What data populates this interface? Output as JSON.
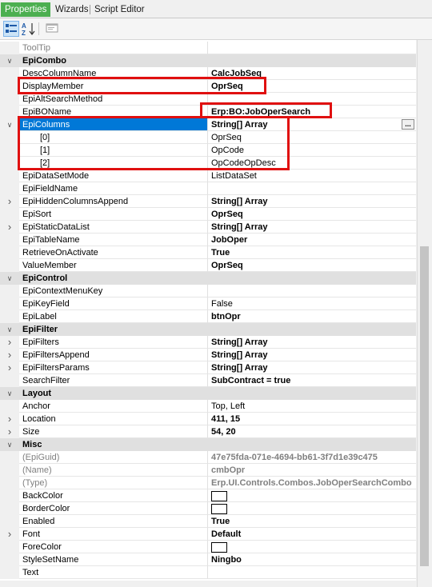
{
  "tabs": [
    {
      "label": "Properties",
      "active": true
    },
    {
      "label": "Wizards",
      "active": false
    },
    {
      "label": "Script Editor",
      "active": false
    }
  ],
  "toolbar": {
    "categorized_icon": "categorized-view-icon",
    "alphabetical_icon": "sort-alphabetical-icon",
    "property_pages_icon": "property-pages-icon",
    "alpha_label": "A",
    "alpha_label2": "Z"
  },
  "colors": {
    "accent_tab": "#4caf50",
    "selection": "#0078d7",
    "highlight_box": "#e01010"
  },
  "rows": [
    {
      "name": "ToolTip",
      "value": "",
      "kind": "prop",
      "readonly": true
    },
    {
      "name": "EpiCombo",
      "kind": "cat"
    },
    {
      "name": "DescColumnName",
      "value": "CalcJobSeq",
      "kind": "prop",
      "bold": true
    },
    {
      "name": "DisplayMember",
      "value": "OprSeq",
      "kind": "prop",
      "bold": true
    },
    {
      "name": "EpiAltSearchMethod",
      "value": "",
      "kind": "prop"
    },
    {
      "name": "EpiBOName",
      "value": "Erp:BO:JobOperSearch",
      "kind": "prop",
      "bold": true
    },
    {
      "name": "EpiColumns",
      "value": "String[] Array",
      "kind": "prop",
      "bold": true,
      "expanded": true,
      "selected": true,
      "ellipsis": true
    },
    {
      "name": "[0]",
      "value": "OprSeq",
      "kind": "sub"
    },
    {
      "name": "[1]",
      "value": "OpCode",
      "kind": "sub"
    },
    {
      "name": "[2]",
      "value": "OpCodeOpDesc",
      "kind": "sub"
    },
    {
      "name": "EpiDataSetMode",
      "value": "ListDataSet",
      "kind": "prop"
    },
    {
      "name": "EpiFieldName",
      "value": "",
      "kind": "prop"
    },
    {
      "name": "EpiHiddenColumnsAppend",
      "value": "String[] Array",
      "kind": "prop",
      "bold": true,
      "expandable": true
    },
    {
      "name": "EpiSort",
      "value": "OprSeq",
      "kind": "prop",
      "bold": true
    },
    {
      "name": "EpiStaticDataList",
      "value": "String[] Array",
      "kind": "prop",
      "bold": true,
      "expandable": true
    },
    {
      "name": "EpiTableName",
      "value": "JobOper",
      "kind": "prop",
      "bold": true
    },
    {
      "name": "RetrieveOnActivate",
      "value": "True",
      "kind": "prop",
      "bold": true
    },
    {
      "name": "ValueMember",
      "value": "OprSeq",
      "kind": "prop",
      "bold": true
    },
    {
      "name": "EpiControl",
      "kind": "cat"
    },
    {
      "name": "EpiContextMenuKey",
      "value": "",
      "kind": "prop"
    },
    {
      "name": "EpiKeyField",
      "value": "False",
      "kind": "prop"
    },
    {
      "name": "EpiLabel",
      "value": "btnOpr",
      "kind": "prop",
      "bold": true
    },
    {
      "name": "EpiFilter",
      "kind": "cat"
    },
    {
      "name": "EpiFilters",
      "value": "String[] Array",
      "kind": "prop",
      "bold": true,
      "expandable": true
    },
    {
      "name": "EpiFiltersAppend",
      "value": "String[] Array",
      "kind": "prop",
      "bold": true,
      "expandable": true
    },
    {
      "name": "EpiFiltersParams",
      "value": "String[] Array",
      "kind": "prop",
      "bold": true,
      "expandable": true
    },
    {
      "name": "SearchFilter",
      "value": "SubContract = true",
      "kind": "prop",
      "bold": true
    },
    {
      "name": "Layout",
      "kind": "cat"
    },
    {
      "name": "Anchor",
      "value": "Top, Left",
      "kind": "prop"
    },
    {
      "name": "Location",
      "value": "411, 15",
      "kind": "prop",
      "bold": true,
      "expandable": true
    },
    {
      "name": "Size",
      "value": "54, 20",
      "kind": "prop",
      "bold": true,
      "expandable": true
    },
    {
      "name": "Misc",
      "kind": "cat"
    },
    {
      "name": "(EpiGuid)",
      "value": "47e75fda-071e-4694-bb61-3f7d1e39c475",
      "kind": "prop",
      "readonly": true,
      "bold": true
    },
    {
      "name": "(Name)",
      "value": "cmbOpr",
      "kind": "prop",
      "readonly": true,
      "bold": true
    },
    {
      "name": "(Type)",
      "value": "Erp.UI.Controls.Combos.JobOperSearchCombo",
      "kind": "prop",
      "readonly": true,
      "bold": true
    },
    {
      "name": "BackColor",
      "value": "",
      "kind": "prop",
      "swatch": true
    },
    {
      "name": "BorderColor",
      "value": "",
      "kind": "prop",
      "swatch": true
    },
    {
      "name": "Enabled",
      "value": "True",
      "kind": "prop",
      "bold": true
    },
    {
      "name": "Font",
      "value": "Default",
      "kind": "prop",
      "bold": true,
      "expandable": true
    },
    {
      "name": "ForeColor",
      "value": "",
      "kind": "prop",
      "swatch": true
    },
    {
      "name": "StyleSetName",
      "value": "Ningbo",
      "kind": "prop",
      "bold": true
    },
    {
      "name": "Text",
      "value": "",
      "kind": "prop"
    }
  ],
  "ellipsis_label": "..."
}
